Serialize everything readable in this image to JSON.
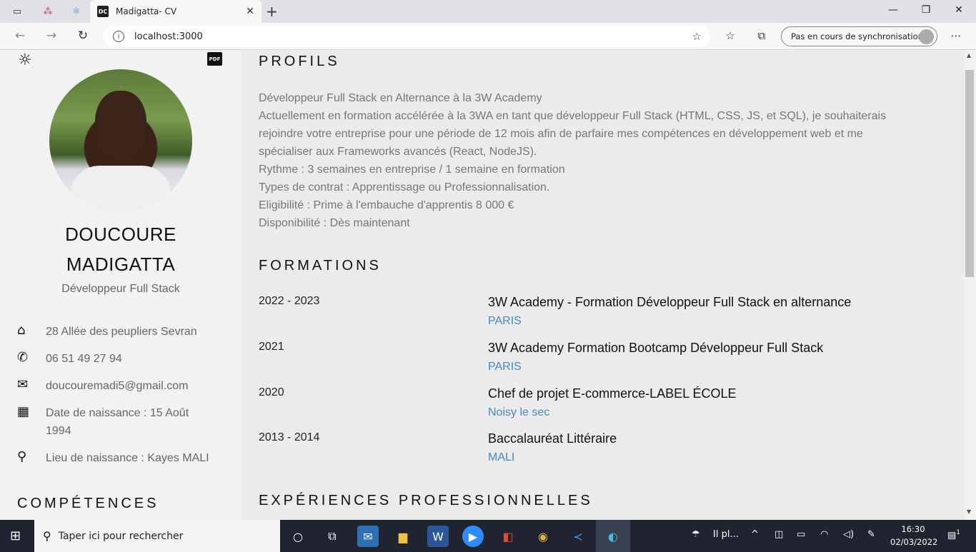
{
  "browser": {
    "tab_title": "Madigatta- CV",
    "favicon_text": "DC",
    "url": "localhost:3000",
    "sync_label": "Pas en cours de synchronisation"
  },
  "sidebar": {
    "pdf_label": "PDF",
    "name_line1": "DOUCOURE",
    "name_line2": "MADIGATTA",
    "role": "Développeur Full Stack",
    "contacts": [
      {
        "icon": "home-icon",
        "text": "28 Allée des peupliers Sevran"
      },
      {
        "icon": "phone-icon",
        "text": "06 51 49 27 94"
      },
      {
        "icon": "mail-icon",
        "text": "doucouremadi5@gmail.com"
      },
      {
        "icon": "calendar-icon",
        "text": "Date de naissance : 15 Août 1994"
      },
      {
        "icon": "location-icon",
        "text": "Lieu de naissance : Kayes MALI"
      }
    ],
    "competences_title": "COMPÉTENCES"
  },
  "main": {
    "profils_title": "PROFILS",
    "profile_lines": [
      "Développeur Full Stack en Alternance à la 3W Academy",
      "Actuellement en formation accélérée à la 3WA en tant que développeur Full Stack (HTML, CSS, JS, et SQL), je souhaiterais",
      "rejoindre votre entreprise pour une période de 12 mois afin de parfaire mes compétences en développement web et me",
      "spécialiser aux Frameworks avancés (React, NodeJS).",
      "Rythme : 3 semaines en entreprise / 1 semaine en formation",
      "Types de contrat : Apprentissage ou Professionnalisation.",
      "Eligibilité : Prime à l'embauche d'apprentis 8 000 €",
      "Disponibilité : Dès maintenant"
    ],
    "formations_title": "FORMATIONS",
    "formations": [
      {
        "year": "2022 - 2023",
        "title": "3W Academy - Formation Développeur Full Stack en alternance",
        "place": "PARIS"
      },
      {
        "year": "2021",
        "title": "3W Academy Formation Bootcamp Développeur Full Stack",
        "place": "PARIS"
      },
      {
        "year": "2020",
        "title": "Chef de projet E-commerce-LABEL ÉCOLE",
        "place": "Noisy le sec"
      },
      {
        "year": "2013 - 2014",
        "title": "Baccalauréat Littéraire",
        "place": "MALI"
      }
    ],
    "experiences_title": "EXPÉRIENCES PROFESSIONNELLES"
  },
  "taskbar": {
    "search_placeholder": "Taper ici pour rechercher",
    "weather_text": "Il pl...",
    "time": "16:30",
    "date": "02/03/2022",
    "notification_count": "1"
  }
}
